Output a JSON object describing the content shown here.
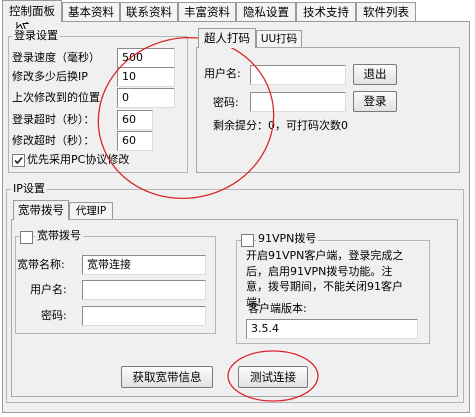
{
  "main_tabs": [
    {
      "label": "控制面板"
    },
    {
      "label": "基本资料"
    },
    {
      "label": "联系资料"
    },
    {
      "label": "丰富资料"
    },
    {
      "label": "隐私设置"
    },
    {
      "label": "技术支持"
    },
    {
      "label": "软件列表"
    }
  ],
  "login_settings": {
    "title": "登录设置",
    "fields": [
      {
        "label": "登录速度（毫秒）",
        "value": "500"
      },
      {
        "label": "修改多少后换IP",
        "value": "10"
      },
      {
        "label": "上次修改到的位置",
        "value": "0"
      },
      {
        "label": "登录超时（秒）：",
        "value": "60"
      },
      {
        "label": "修改超时（秒）：",
        "value": "60"
      }
    ],
    "pc_protocol_checkbox": {
      "label": "优先采用PC协议修改",
      "checked": true
    }
  },
  "captcha": {
    "tabs": [
      {
        "label": "超人打码"
      },
      {
        "label": "UU打码"
      }
    ],
    "username_label": "用户名:",
    "username_value": "",
    "password_label": "密码:",
    "password_value": "",
    "logout_button": "退出",
    "login_button": "登录",
    "balance_text": "剩余提分：0，可打码次数0"
  },
  "ip_settings": {
    "title": "IP设置",
    "tabs": [
      {
        "label": "宽带拨号"
      },
      {
        "label": "代理IP"
      }
    ],
    "broadband": {
      "checkbox_label": "宽带拨号",
      "checked": false,
      "name_label": "宽带名称:",
      "name_value": "宽带连接",
      "user_label": "用户名:",
      "user_value": "",
      "password_label": "密码:",
      "password_value": ""
    },
    "vpn": {
      "checkbox_label": "91VPN拨号",
      "checked": false,
      "hint": "开启91VPN客户端，登录完成之后，启用91VPN拨号功能。注意，拨号期间，不能关闭91客户端!",
      "version_label": "客户端版本:",
      "version_value": "3.5.4"
    },
    "get_info_button": "获取宽带信息",
    "test_button": "测试连接"
  },
  "colors": {
    "annotation_circle": "#d9262c",
    "panel_bg": "#f0f0f0"
  }
}
